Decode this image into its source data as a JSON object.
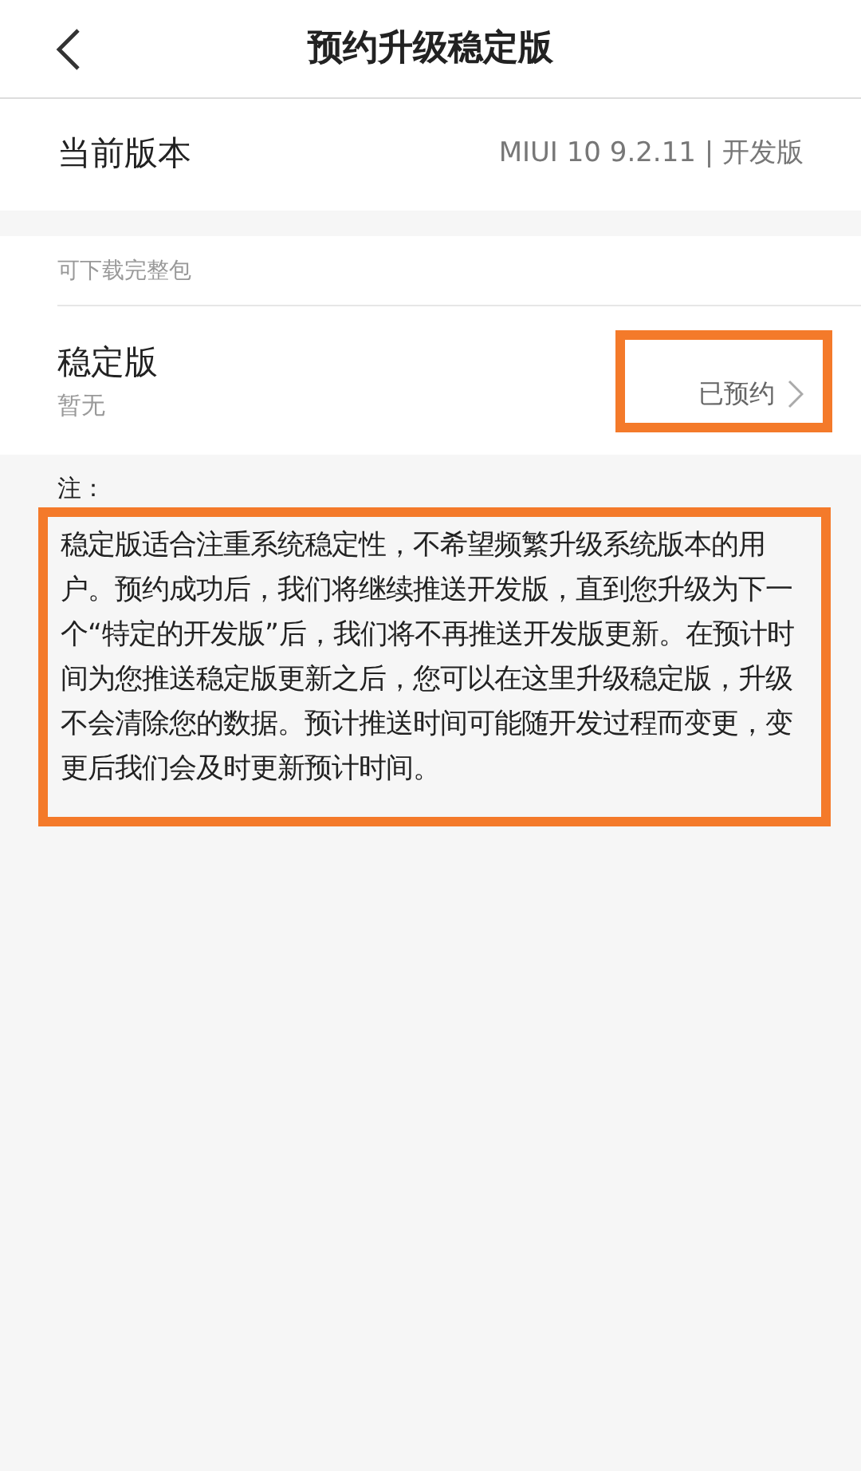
{
  "header": {
    "title": "预约升级稳定版"
  },
  "current_version": {
    "label": "当前版本",
    "value": "MIUI 10 9.2.11 | 开发版"
  },
  "section": {
    "title": "可下载完整包",
    "items": [
      {
        "title": "稳定版",
        "subtitle": "暂无",
        "status": "已预约",
        "highlighted": true
      }
    ]
  },
  "note": {
    "label": "注：",
    "text": "稳定版适合注重系统稳定性，不希望频繁升级系统版本的用户。预约成功后，我们将继续推送开发版，直到您升级为下一个“特定的开发版”后，我们将不再推送开发版更新。在预计时间为您推送稳定版更新之后，您可以在这里升级稳定版，升级不会清除您的数据。预计推送时间可能随开发过程而变更，变更后我们会及时更新预计时间。",
    "highlighted": true
  }
}
